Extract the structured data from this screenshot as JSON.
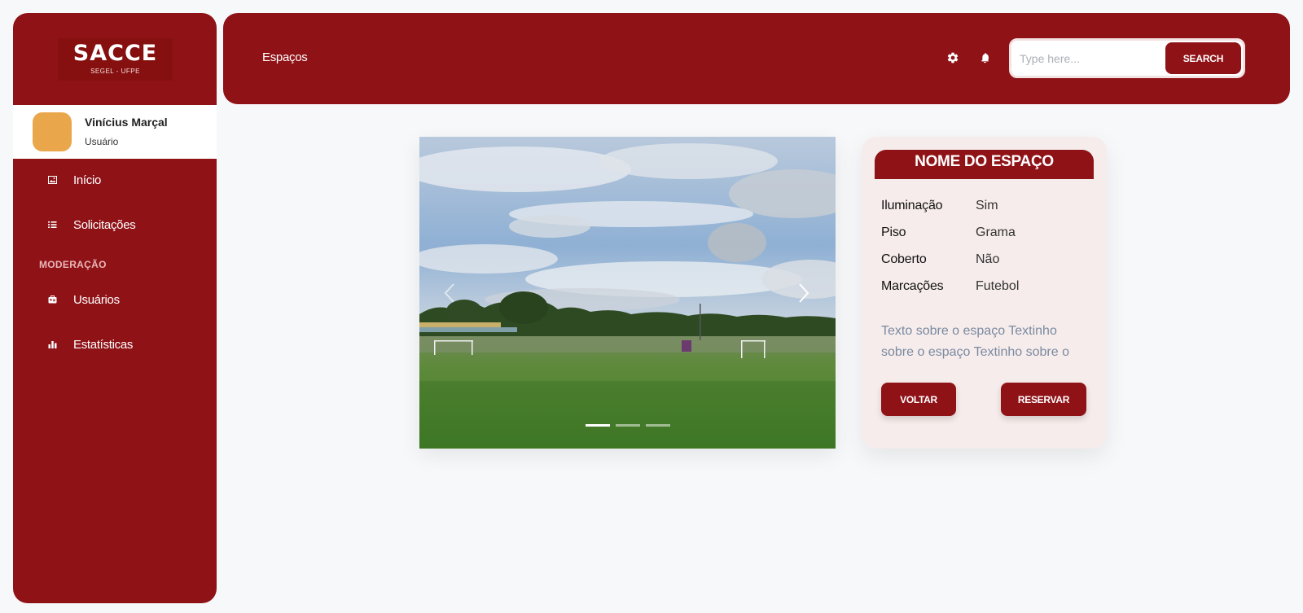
{
  "sidebar": {
    "logo_title": "SACCE",
    "logo_subtitle": "SEGEL - UFPE",
    "user": {
      "name": "Vinícius Marçal",
      "role": "Usuário"
    },
    "nav": [
      {
        "label": "Início",
        "icon": "image-icon"
      },
      {
        "label": "Solicitações",
        "icon": "list-icon"
      }
    ],
    "section_label": "MODERAÇÃO",
    "moderation_nav": [
      {
        "label": "Usuários",
        "icon": "users-icon"
      },
      {
        "label": "Estatísticas",
        "icon": "bar-chart-icon"
      }
    ]
  },
  "topbar": {
    "breadcrumb": "Espaços",
    "search_placeholder": "Type here...",
    "search_button": "SEARCH"
  },
  "carousel": {
    "slides": 3,
    "active_slide": 1
  },
  "space": {
    "title": "NOME DO ESPAÇO",
    "properties": [
      {
        "key": "Iluminação",
        "value": "Sim"
      },
      {
        "key": "Piso",
        "value": "Grama"
      },
      {
        "key": "Coberto",
        "value": "Não"
      },
      {
        "key": "Marcações",
        "value": "Futebol"
      }
    ],
    "description": "Texto sobre o espaço Textinho sobre o espaço Textinho sobre o",
    "back_button": "VOLTAR",
    "reserve_button": "RESERVAR"
  },
  "colors": {
    "primary": "#8f1217",
    "background": "#f7f8fa",
    "card": "#f6eceb",
    "avatar": "#eaa64a"
  }
}
